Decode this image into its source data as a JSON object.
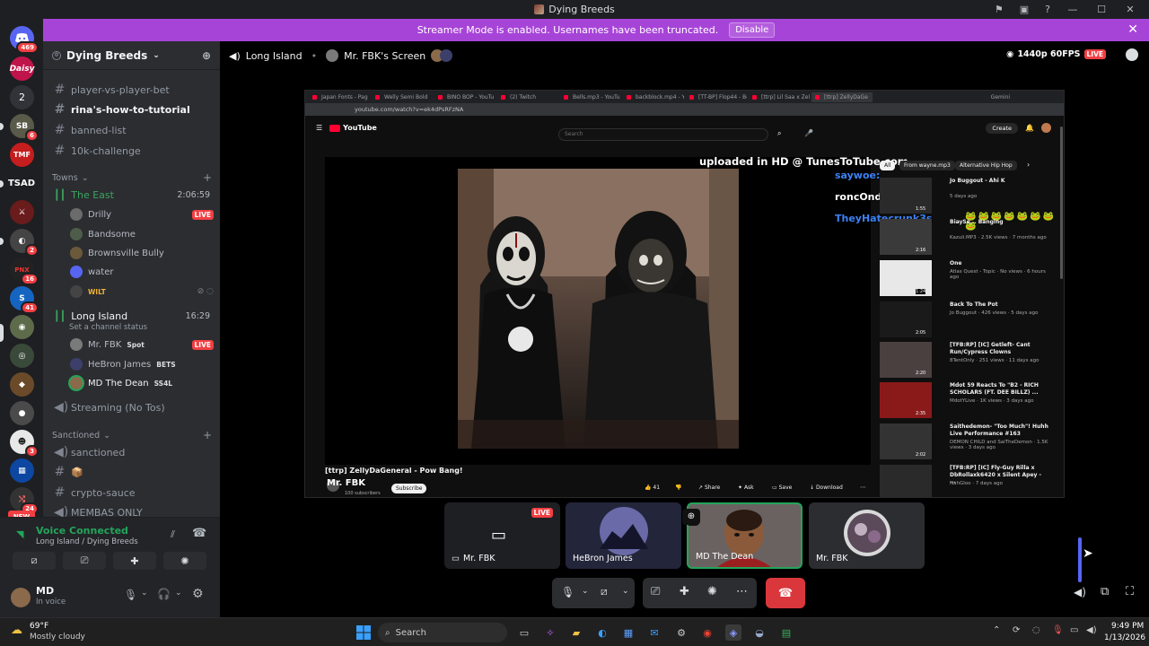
{
  "window": {
    "title": "Dying Breeds"
  },
  "banner": {
    "text": "Streamer Mode is enabled. Usernames have been truncated.",
    "disable_label": "Disable"
  },
  "servers": {
    "home_badge": "469",
    "dm_count": "2",
    "badges": {
      "s4": "6",
      "s8": "2",
      "s9": "16",
      "s10": "41",
      "s15": "3",
      "s17": "24"
    },
    "tsad": "TSAD",
    "tmf": "TMF",
    "new": "NEW"
  },
  "guild": {
    "name": "Dying Breeds",
    "icon": "chevron-down-icon"
  },
  "channels": {
    "top": [
      "player-vs-player-bet",
      "rina's-how-to-tutorial",
      "banned-list",
      "10k-challenge"
    ],
    "towns_label": "Towns",
    "east": {
      "name": "The East",
      "duration": "2:06:59"
    },
    "east_users": [
      {
        "name": "Drilly",
        "live": "LIVE"
      },
      {
        "name": "Bandsome"
      },
      {
        "name": "Brownsville Bully"
      },
      {
        "name": "water"
      },
      {
        "name": "WILT"
      }
    ],
    "li": {
      "name": "Long Island",
      "duration": "16:29",
      "status": "Set a channel status"
    },
    "li_users": [
      {
        "name": "Mr. FBK",
        "tag": "Spot",
        "live": "LIVE"
      },
      {
        "name": "HeBron James",
        "tag": "BETS"
      },
      {
        "name": "MD The Dean",
        "tag": "SS4L"
      }
    ],
    "streaming": "Streaming (No Tos)",
    "sanctioned_label": "Sanctioned",
    "sanctioned": [
      "sanctioned",
      "📦",
      "crypto-sauce",
      "MEMBAS ONLY"
    ]
  },
  "voice": {
    "status": "Voice Connected",
    "location": "Long Island / Dying Breeds"
  },
  "user": {
    "name": "MD",
    "status": "In voice"
  },
  "stage": {
    "channel": "Long Island",
    "screen": "Mr. FBK's Screen",
    "quality": "1440p 60FPS",
    "live": "LIVE"
  },
  "browser": {
    "tabs": [
      "Japan Fonts - Pag",
      "Welly Semi Bold",
      "BINO BOP - YouTu",
      "(2) Twitch",
      "Bells.mp3 - YouTu",
      "backblock.mp4 - Y",
      "[TT-BP] Flop44 - Bo",
      "[ttrp] Lil Saa x Zelly",
      "[ttrp] ZellyDaGe"
    ],
    "gemini": "Gemini",
    "url": "youtube.com/watch?v=ek4dPsRFzNA",
    "yt_logo": "YouTube",
    "search_placeholder": "Search",
    "create": "Create",
    "overlay": "uploaded in HD @ TunesToTube.com",
    "video_title": "[ttrp] ZellyDaGeneral - Pow Bang!",
    "channel": "Mr. FBK",
    "channel_sub": "100 subscribers",
    "subscribe": "Subscribe",
    "likes": "41",
    "share": "Share",
    "ask": "Ask",
    "save": "Save",
    "download": "Download",
    "chips": [
      "All",
      "From wayne.mp3",
      "Alternative Hip Hop"
    ],
    "chat": [
      {
        "name": "saywoe:",
        "color": "#3b82f6"
      },
      {
        "name": "roncOndones:",
        "color": "#ffffff"
      },
      {
        "name": "TheyHatecrunk3s",
        "color": "#3b82f6"
      }
    ],
    "related": [
      {
        "title": "Jo Buggout - Ahi K",
        "meta": "5 days ago",
        "dur": "1:55"
      },
      {
        "title": "BiaySe... Banging",
        "meta": "Kazuli.MP3 · 2.5K views · 7 months ago",
        "dur": "2:16"
      },
      {
        "title": "One",
        "meta": "Atlas Quest - Topic · No views · 6 hours ago",
        "dur": "1:24"
      },
      {
        "title": "Back To The Pot",
        "meta": "Jo Buggout · 426 views · 5 days ago",
        "dur": "2:05"
      },
      {
        "title": "[TFB:RP] [IC] Getleft- Cant Run/Cypress Clowns",
        "meta": "8TentOnly · 251 views · 11 days ago",
        "dur": "2:20"
      },
      {
        "title": "Mdot 59 Reacts To \"B2 - RICH SCHOLARS (FT. DEE BILLZ) ...",
        "meta": "MdotYLive · 1K views · 3 days ago",
        "dur": "2:35"
      },
      {
        "title": "Saithedemon- \"Too Much\"! Huhh Live Performance #163",
        "meta": "DEMON CHILD and SaiTheDemon · 1.5K views · 3 days ago",
        "dur": "2:02"
      },
      {
        "title": "[TFB:RP] [IC] Fly-Guy Rilla x DbRollaxk6420 x Silent Apey - ...",
        "meta": "NahGloo · 7 days ago",
        "dur": ""
      }
    ]
  },
  "tiles": [
    {
      "name": "Mr. FBK",
      "live": "LIVE"
    },
    {
      "name": "HeBron James"
    },
    {
      "name": "MD The Dean"
    },
    {
      "name": "Mr. FBK"
    }
  ],
  "taskbar": {
    "temp": "69°F",
    "weather": "Mostly cloudy",
    "search": "Search",
    "time": "9:49 PM",
    "date": "1/13/2026"
  },
  "colors": {
    "banner": "#a744d8",
    "live": "#f23f43",
    "connected": "#23a55a",
    "hangup": "#da373c"
  }
}
